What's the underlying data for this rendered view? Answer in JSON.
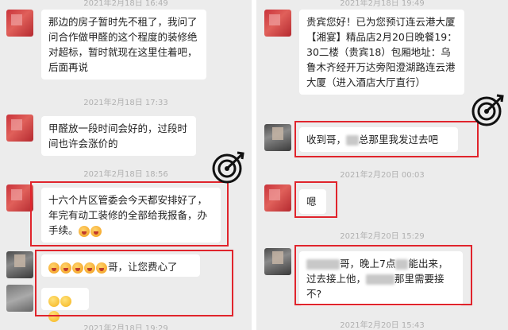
{
  "left": {
    "top_timestamp": "2021年2月18日 16:49",
    "msg1": "那边的房子暂时先不租了，我问了问合作做甲醛的这个程度的装修绝对超标，暂时就现在这里住着吧，后面再说",
    "ts2": "2021年2月18日 17:33",
    "msg2": "甲醛放一段时间会好的，过段时间也许会涨价的",
    "ts3": "2021年2月18日 18:56",
    "msg3": "十六个片区管委会今天都安排好了，年完有动工装修的全部给我报备，办手续。",
    "msg4_suffix": "哥，让您费心了",
    "bottom_timestamp": "2021年2月18日 19:29"
  },
  "right": {
    "top_timestamp": "2021年2月18日 19:49",
    "msg1": "贵宾您好！已为您预订连云港大厦【湘宴】精品店2月20日晚餐19：30二楼（贵宾18）包厢地址：乌鲁木齐经开万达旁阳澄湖路连云港大厦（进入酒店大厅直行）",
    "msg2_prefix": "收到哥，",
    "msg2_suffix": "总那里我发过去吧",
    "ts2": "2021年2月20日 00:03",
    "msg3": "嗯",
    "ts3": "2021年2月20日 15:29",
    "msg4_part1": "哥，晚上7点",
    "msg4_part2": "能出来，过去接上他，",
    "msg4_part3": "那里需要接不?",
    "bottom_timestamp": "2021年2月20日 15:43"
  },
  "colors": {
    "highlight": "#e0242c",
    "chat_bg": "#ececec",
    "bubble": "#ffffff"
  },
  "icons": [
    "target-logo-icon",
    "blurred-avatar",
    "smile-emoji-icon",
    "laughing-emoji-icon"
  ]
}
